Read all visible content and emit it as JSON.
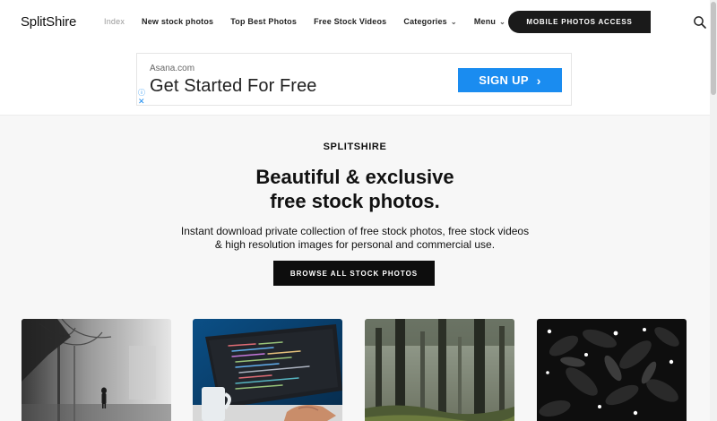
{
  "header": {
    "logo": "SplitShire",
    "nav": {
      "index": "Index",
      "new_stock_photos": "New stock photos",
      "top_best_photos": "Top Best Photos",
      "free_stock_videos": "Free Stock Videos",
      "categories": "Categories",
      "menu": "Menu"
    },
    "cta_label": "MOBILE PHOTOS ACCESS",
    "search_icon": "search-icon"
  },
  "ad": {
    "domain": "Asana.com",
    "headline": "Get Started For Free",
    "button_label": "SIGN UP",
    "chevron": "›",
    "info_glyph": "ⓘ",
    "close_glyph": "✕"
  },
  "hero": {
    "brand": "SPLITSHIRE",
    "title_line1": "Beautiful & exclusive",
    "title_line2": "free stock photos.",
    "subtitle_line1": "Instant download private collection of free stock photos, free stock videos",
    "subtitle_line2": "& high resolution images for personal and commercial use.",
    "browse_label": "BROWSE ALL STOCK PHOTOS"
  },
  "thumbnails": [
    {
      "subject": "foggy-park-figure"
    },
    {
      "subject": "laptop-code-coffee"
    },
    {
      "subject": "misty-forest"
    },
    {
      "subject": "dark-leaves-flowers"
    }
  ],
  "colors": {
    "accent": "#1a8cf0",
    "dark": "#1a1a1a",
    "background": "#f7f7f7"
  }
}
